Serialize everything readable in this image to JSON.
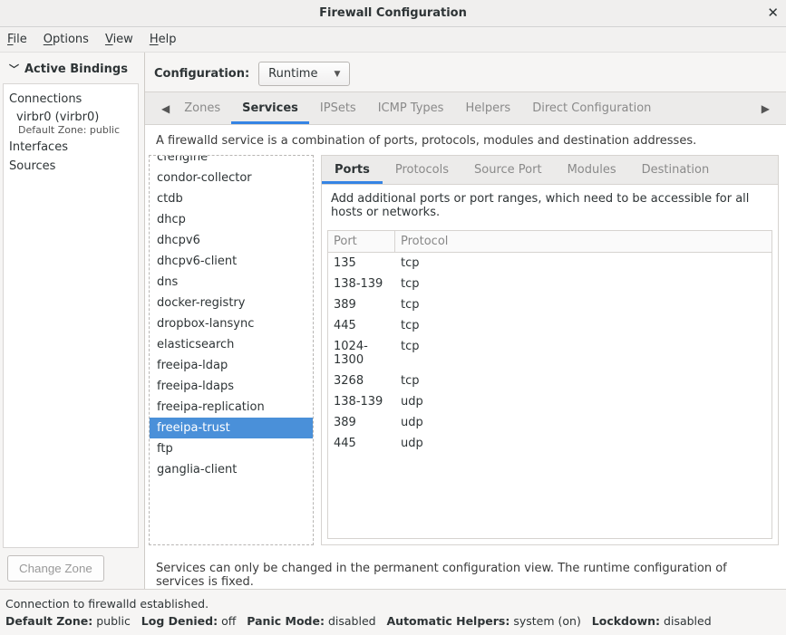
{
  "window": {
    "title": "Firewall Configuration"
  },
  "menu": {
    "file": "File",
    "options": "Options",
    "view": "View",
    "help": "Help"
  },
  "sidebar": {
    "header": "Active Bindings",
    "cat_connections": "Connections",
    "conn_name": "virbr0 (virbr0)",
    "conn_sub": "Default Zone: public",
    "cat_interfaces": "Interfaces",
    "cat_sources": "Sources",
    "change_zone": "Change Zone"
  },
  "config": {
    "label": "Configuration:",
    "value": "Runtime"
  },
  "tabs": {
    "zones": "Zones",
    "services": "Services",
    "ipsets": "IPSets",
    "icmp": "ICMP Types",
    "helpers": "Helpers",
    "direct": "Direct Configuration"
  },
  "service_desc": "A firewalld service is a combination of ports, protocols, modules and destination addresses.",
  "services": [
    "cfengine",
    "condor-collector",
    "ctdb",
    "dhcp",
    "dhcpv6",
    "dhcpv6-client",
    "dns",
    "docker-registry",
    "dropbox-lansync",
    "elasticsearch",
    "freeipa-ldap",
    "freeipa-ldaps",
    "freeipa-replication",
    "freeipa-trust",
    "ftp",
    "ganglia-client"
  ],
  "subtabs": {
    "ports": "Ports",
    "protocols": "Protocols",
    "source_port": "Source Port",
    "modules": "Modules",
    "destination": "Destination"
  },
  "ports_desc": "Add additional ports or port ranges, which need to be accessible for all hosts or networks.",
  "table": {
    "head_port": "Port",
    "head_proto": "Protocol",
    "rows": [
      {
        "port": "135",
        "proto": "tcp"
      },
      {
        "port": "138-139",
        "proto": "tcp"
      },
      {
        "port": "389",
        "proto": "tcp"
      },
      {
        "port": "445",
        "proto": "tcp"
      },
      {
        "port": "1024-1300",
        "proto": "tcp"
      },
      {
        "port": "3268",
        "proto": "tcp"
      },
      {
        "port": "138-139",
        "proto": "udp"
      },
      {
        "port": "389",
        "proto": "udp"
      },
      {
        "port": "445",
        "proto": "udp"
      }
    ]
  },
  "footnote": "Services can only be changed in the permanent configuration view. The runtime configuration of services is fixed.",
  "status": {
    "line1": "Connection to firewalld established.",
    "dz_label": "Default Zone:",
    "dz_val": "public",
    "ld_label": "Log Denied:",
    "ld_val": "off",
    "pm_label": "Panic Mode:",
    "pm_val": "disabled",
    "ah_label": "Automatic Helpers:",
    "ah_val": "system (on)",
    "lk_label": "Lockdown:",
    "lk_val": "disabled"
  }
}
